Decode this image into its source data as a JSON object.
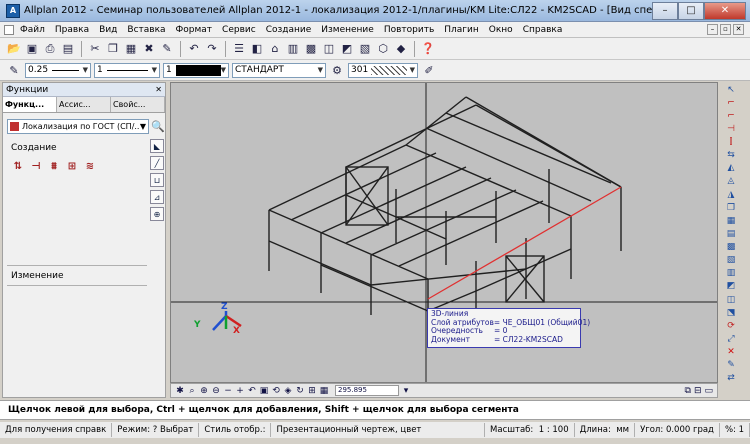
{
  "window": {
    "app_icon": "A",
    "title": "Allplan 2012 - Семинар пользователей Allplan 2012-1 - локализация 2012-1/плагины/KM Lite:СЛ22 - KM2SCAD - [Вид спереди слева, изометрия с юго-запада]",
    "minimize": "–",
    "maximize": "□",
    "close": "✕"
  },
  "menu": [
    "Файл",
    "Правка",
    "Вид",
    "Вставка",
    "Формат",
    "Сервис",
    "Создание",
    "Изменение",
    "Повторить",
    "Плагин",
    "Окно",
    "Справка"
  ],
  "format_bar": {
    "pen_thickness": "0.25",
    "line_type": "1",
    "color_number": "1",
    "layer": "СТАНДАРТ",
    "hatch": "301"
  },
  "panel": {
    "title": "Функции",
    "tabs": [
      "Функц...",
      "Асcис...",
      "Свойс..."
    ],
    "localization": "Локализация по ГОСТ (СП/...",
    "section_create": "Создание",
    "section_change": "Изменение"
  },
  "infobox": {
    "type": "3D-линия",
    "rows": [
      {
        "key": "Слой атрибутов",
        "value": "= ЧЕ_ОБЩ01 (Общий01)"
      },
      {
        "key": "Очередность",
        "value": "= 0"
      },
      {
        "key": "Документ",
        "value": "= СЛ22-KM2SCAD"
      }
    ]
  },
  "axes": {
    "x": "X",
    "y": "Y",
    "z": "Z"
  },
  "view_toolbar": {
    "coord": "295.895"
  },
  "message": "Щелчок левой для выбора, Ctrl + щелчок для добавления, Shift + щелчок для выбора сегмента",
  "status": {
    "help": "Для получения справк",
    "mode_label": "Режим:",
    "mode_value": "? Выбрат",
    "display_style": "Стиль отобр.:",
    "drawing_type": "Презентационный чертеж, цвет",
    "scale_label": "Масштаб:",
    "scale_value": "1 : 100",
    "length_label": "Длина:",
    "length_value": "мм",
    "angle_label": "Угол:",
    "angle_value": "0.000",
    "angle_unit": "град",
    "percent": "%: 1"
  },
  "colors": {
    "highlight": "#e03030",
    "frame": "#202020",
    "infobox_border": "#3a3ab0"
  }
}
